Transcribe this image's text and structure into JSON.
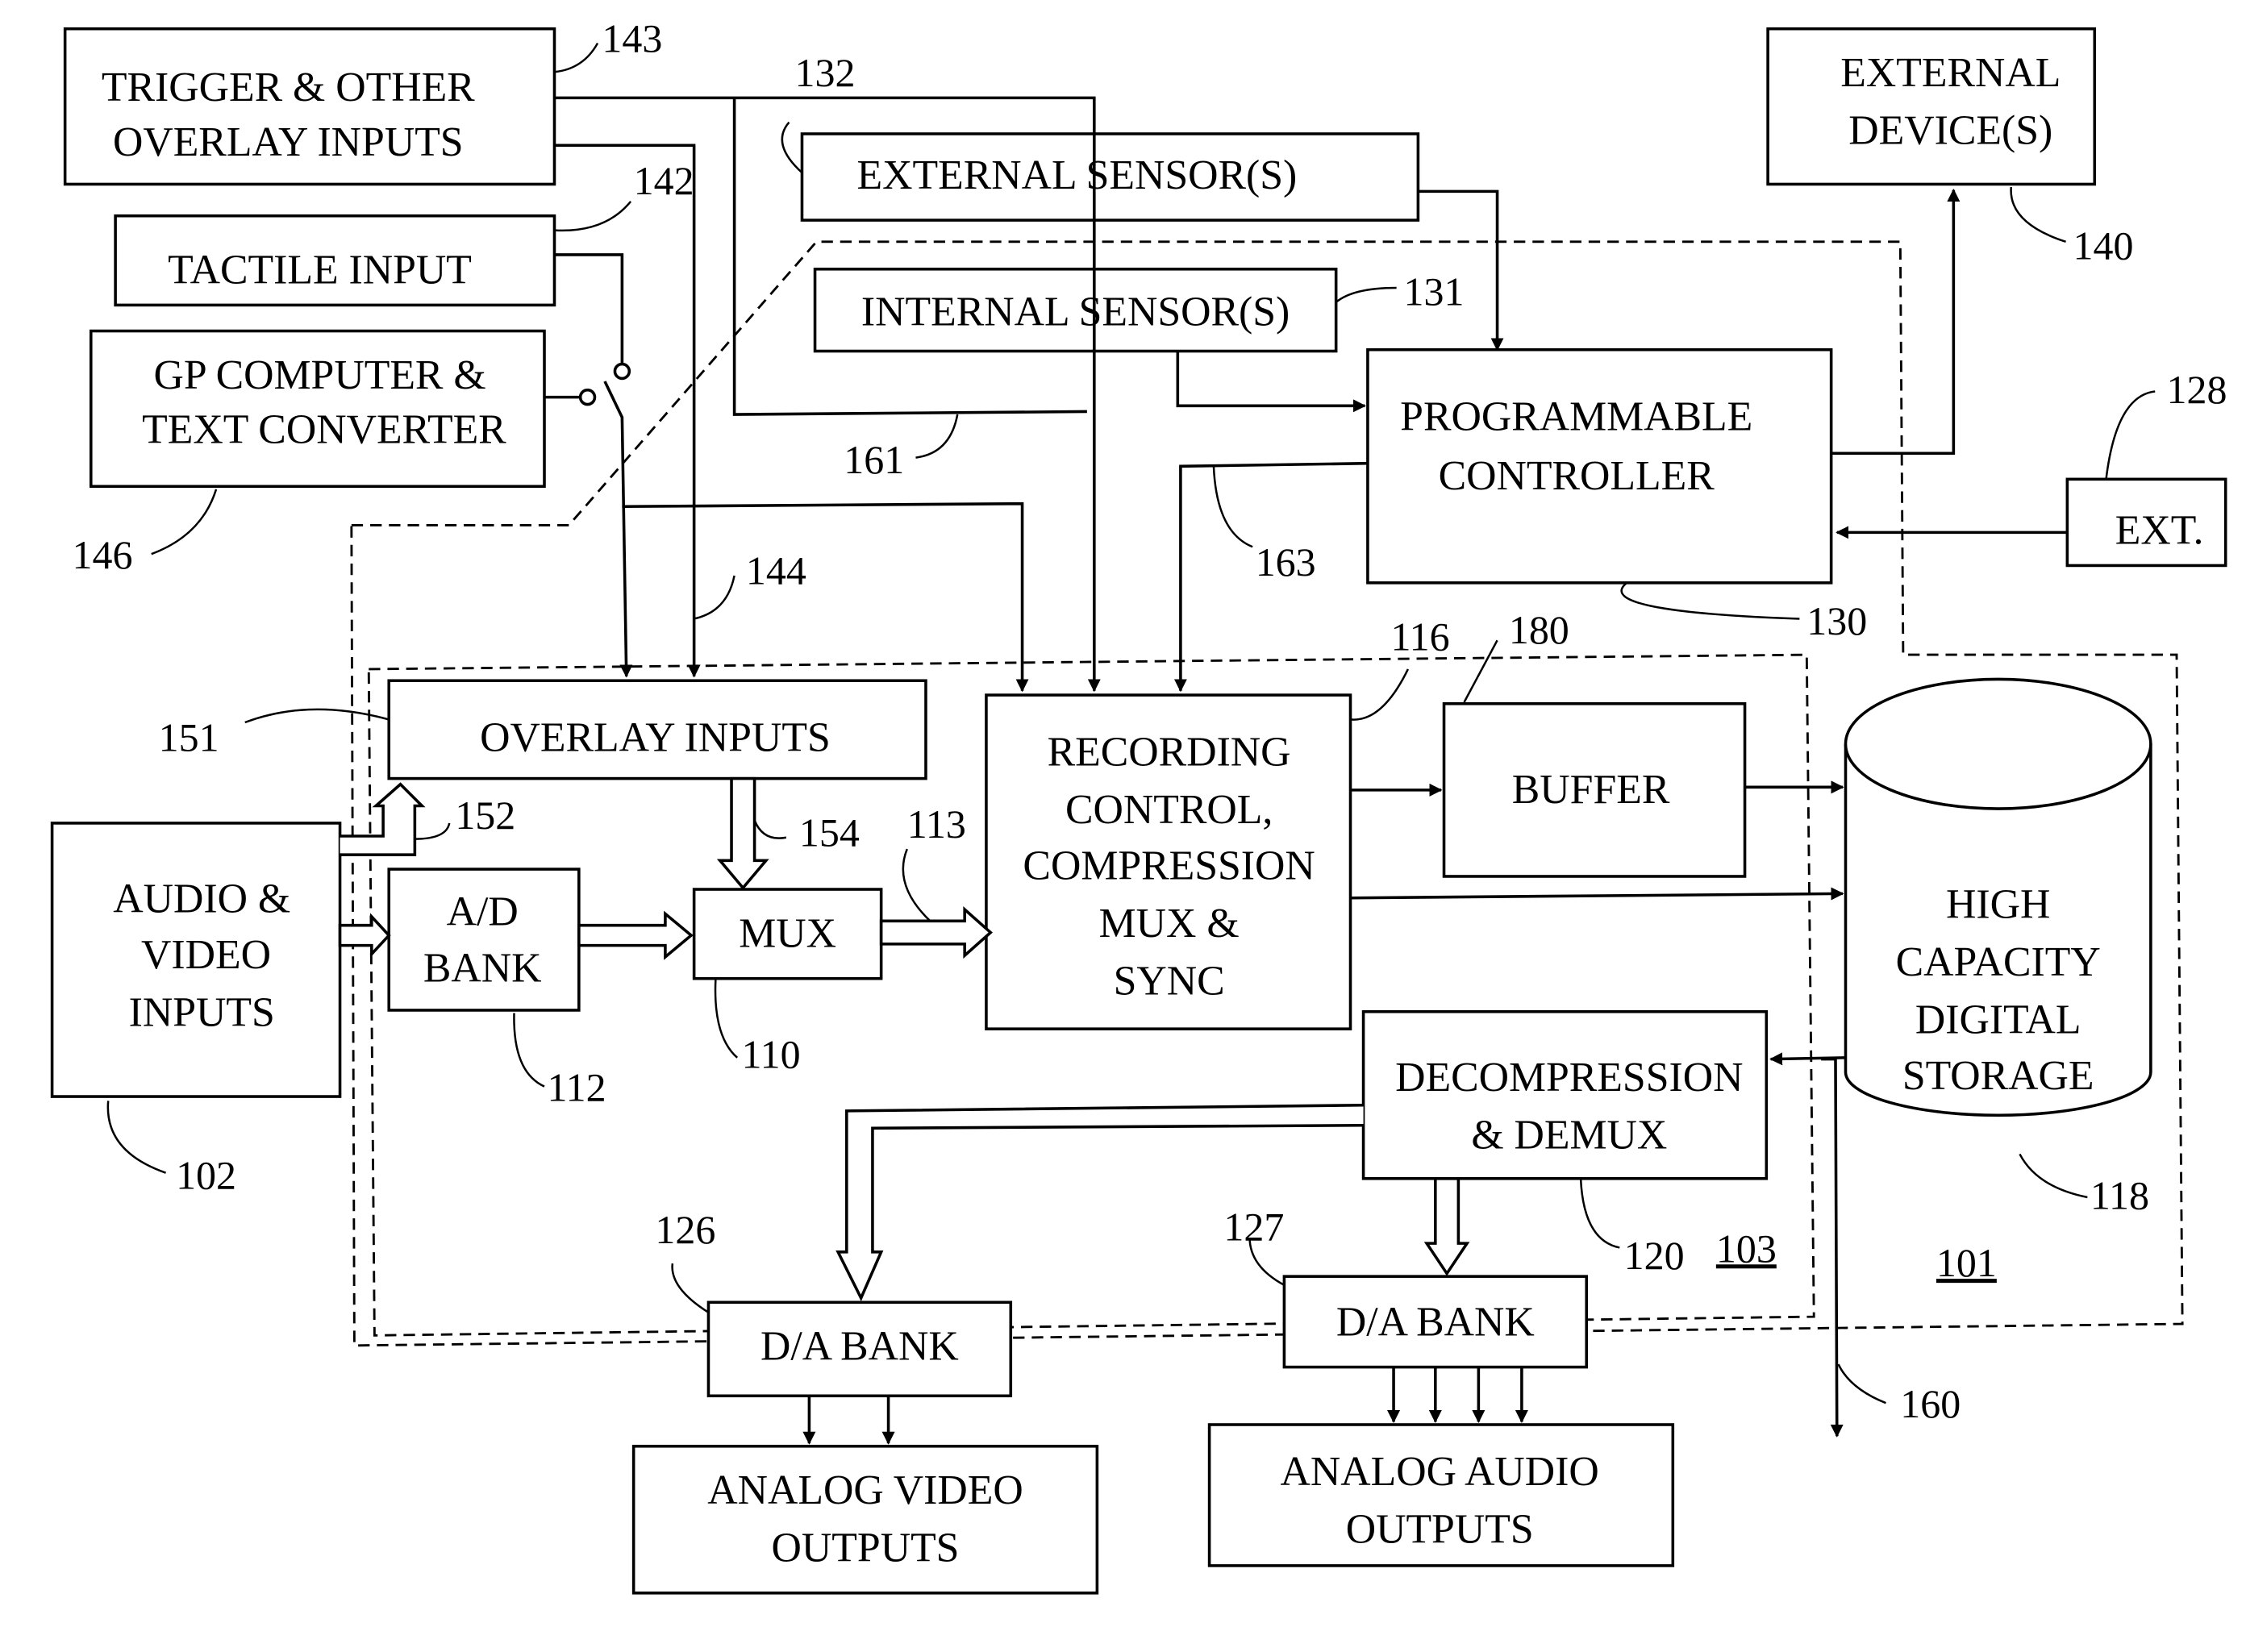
{
  "figure": {
    "type": "block-diagram",
    "description": "Audio/video recording system block diagram"
  },
  "blocks": {
    "trigger": {
      "lines": [
        "TRIGGER & OTHER",
        "OVERLAY INPUTS"
      ],
      "ref": "143"
    },
    "tactile": {
      "lines": [
        "TACTILE INPUT"
      ],
      "ref": "142"
    },
    "gp_computer": {
      "lines": [
        "GP COMPUTER &",
        "TEXT CONVERTER"
      ],
      "ref": "146"
    },
    "external_sensors": {
      "lines": [
        "EXTERNAL SENSOR(S)"
      ],
      "ref": "132"
    },
    "internal_sensors": {
      "lines": [
        "INTERNAL SENSOR(S)"
      ],
      "ref": "131"
    },
    "external_devices": {
      "lines": [
        "EXTERNAL",
        "DEVICE(S)"
      ],
      "ref": "140"
    },
    "programmable_controller": {
      "lines": [
        "PROGRAMMABLE",
        "CONTROLLER"
      ],
      "ref": "130"
    },
    "ext": {
      "lines": [
        "EXT."
      ],
      "ref": "128"
    },
    "overlay_inputs": {
      "lines": [
        "OVERLAY INPUTS"
      ],
      "ref": "151"
    },
    "av_inputs": {
      "lines": [
        "AUDIO &",
        "VIDEO",
        "INPUTS"
      ],
      "ref": "102"
    },
    "ad_bank": {
      "lines": [
        "A/D",
        "BANK"
      ],
      "ref": "112"
    },
    "mux": {
      "lines": [
        "MUX"
      ],
      "ref": "110"
    },
    "recording_control": {
      "lines": [
        "RECORDING",
        "CONTROL,",
        "COMPRESSION",
        "MUX &",
        "SYNC"
      ],
      "ref": "116"
    },
    "buffer": {
      "lines": [
        "BUFFER"
      ],
      "ref": "180"
    },
    "storage": {
      "lines": [
        "HIGH",
        "CAPACITY",
        "DIGITAL",
        "STORAGE"
      ],
      "ref": "118"
    },
    "decompression": {
      "lines": [
        "DECOMPRESSION",
        "& DEMUX"
      ],
      "ref": "120"
    },
    "da_bank_video": {
      "lines": [
        "D/A BANK"
      ],
      "ref": "126"
    },
    "da_bank_audio": {
      "lines": [
        "D/A BANK"
      ],
      "ref": "127"
    },
    "analog_video": {
      "lines": [
        "ANALOG VIDEO",
        "OUTPUTS"
      ]
    },
    "analog_audio": {
      "lines": [
        "ANALOG AUDIO",
        "OUTPUTS"
      ]
    }
  },
  "refs": {
    "r144": "144",
    "r161": "161",
    "r163": "163",
    "r152": "152",
    "r154": "154",
    "r113": "113",
    "r160": "160",
    "r103": "103",
    "r101": "101"
  }
}
